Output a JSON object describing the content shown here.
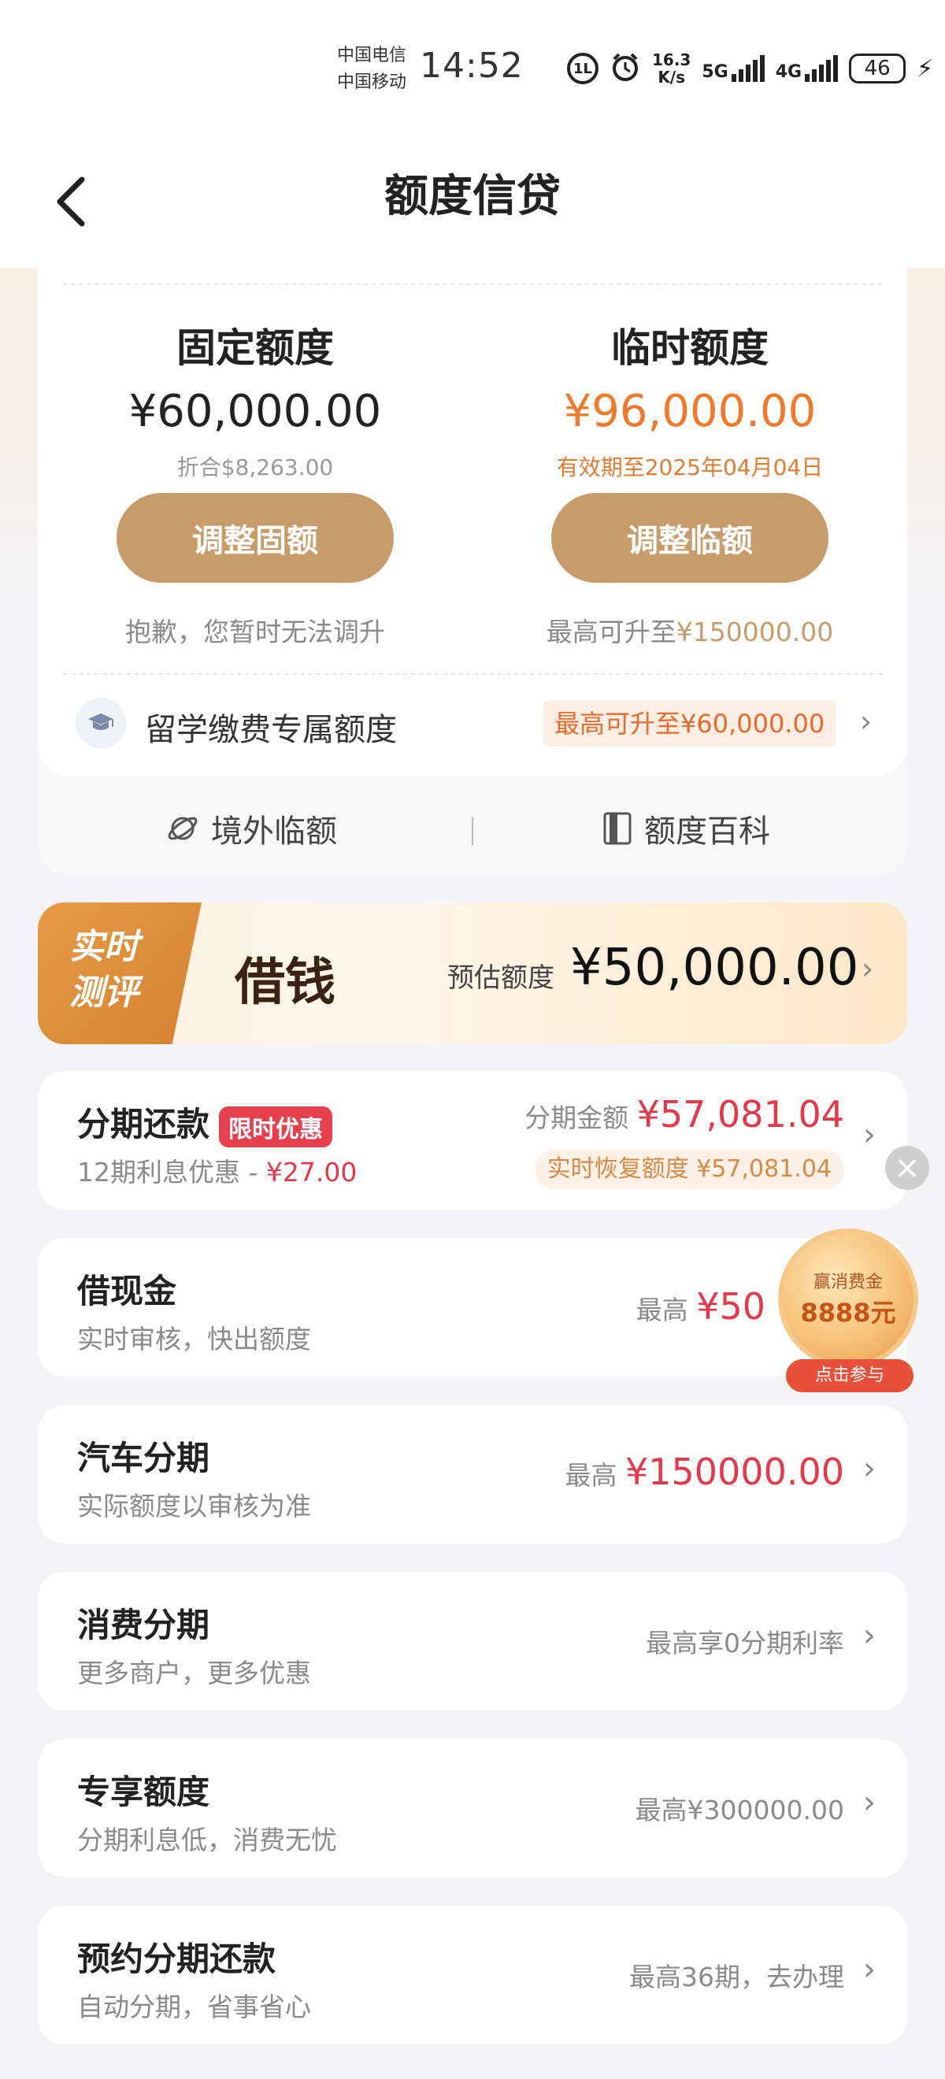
{
  "status_bar": {
    "carrier_1": "中国电信",
    "carrier_2": "中国移动",
    "time": "14:52",
    "hd_badge": "1L",
    "speed_value": "16.3",
    "speed_unit": "K/s",
    "net_1": "5G",
    "net_2": "4G",
    "battery": "46"
  },
  "nav": {
    "title": "额度信贷",
    "back_icon": "chevron-left-icon",
    "mascot_icon": "mascot-icon"
  },
  "quota": {
    "fixed": {
      "title": "固定额度",
      "amount": "¥60,000.00",
      "sub": "折合$8,263.00",
      "button": "调整固额",
      "note": "抱歉，您暂时无法调升"
    },
    "temp": {
      "title": "临时额度",
      "amount": "¥96,000.00",
      "sub": "有效期至2025年04月04日",
      "button": "调整临额",
      "note_prefix": "最高可升至",
      "note_value": "¥150000.00"
    },
    "study": {
      "label": "留学缴费专属额度",
      "badge": "最高可升至¥60,000.00"
    },
    "links": {
      "overseas": "境外临额",
      "wiki": "额度百科"
    }
  },
  "borrow": {
    "tag_line1": "实时",
    "tag_line2": "测评",
    "title": "借钱",
    "estimate_label": "预估额度",
    "estimate_amount": "¥50,000.00"
  },
  "installment": {
    "title": "分期还款",
    "badge": "限时优惠",
    "sub_prefix": "12期利息优惠 - ",
    "sub_value": "¥27.00",
    "amount_label": "分期金额",
    "amount_value": "¥57,081.04",
    "restore": "实时恢复额度 ¥57,081.04"
  },
  "rows": {
    "cash": {
      "title": "借现金",
      "sub": "实时审核，快出额度",
      "right_label": "最高",
      "right_value": "¥50"
    },
    "car": {
      "title": "汽车分期",
      "sub": "实际额度以审核为准",
      "right_label": "最高",
      "right_value": "¥150000.00"
    },
    "consume": {
      "title": "消费分期",
      "sub": "更多商户，更多优惠",
      "right": "最高享0分期利率"
    },
    "exclusive": {
      "title": "专享额度",
      "sub": "分期利息低，消费无忧",
      "right": "最高¥300000.00"
    },
    "booking": {
      "title": "预约分期还款",
      "sub": "自动分期，省事省心",
      "right": "最高36期，去办理"
    }
  },
  "floating": {
    "coin_label": "赢消费金",
    "coin_value": "8888元",
    "coin_button": "点击参与"
  },
  "colors": {
    "accent_gold": "#c89b6a",
    "orange": "#f07a2a",
    "red": "#e5384a"
  }
}
